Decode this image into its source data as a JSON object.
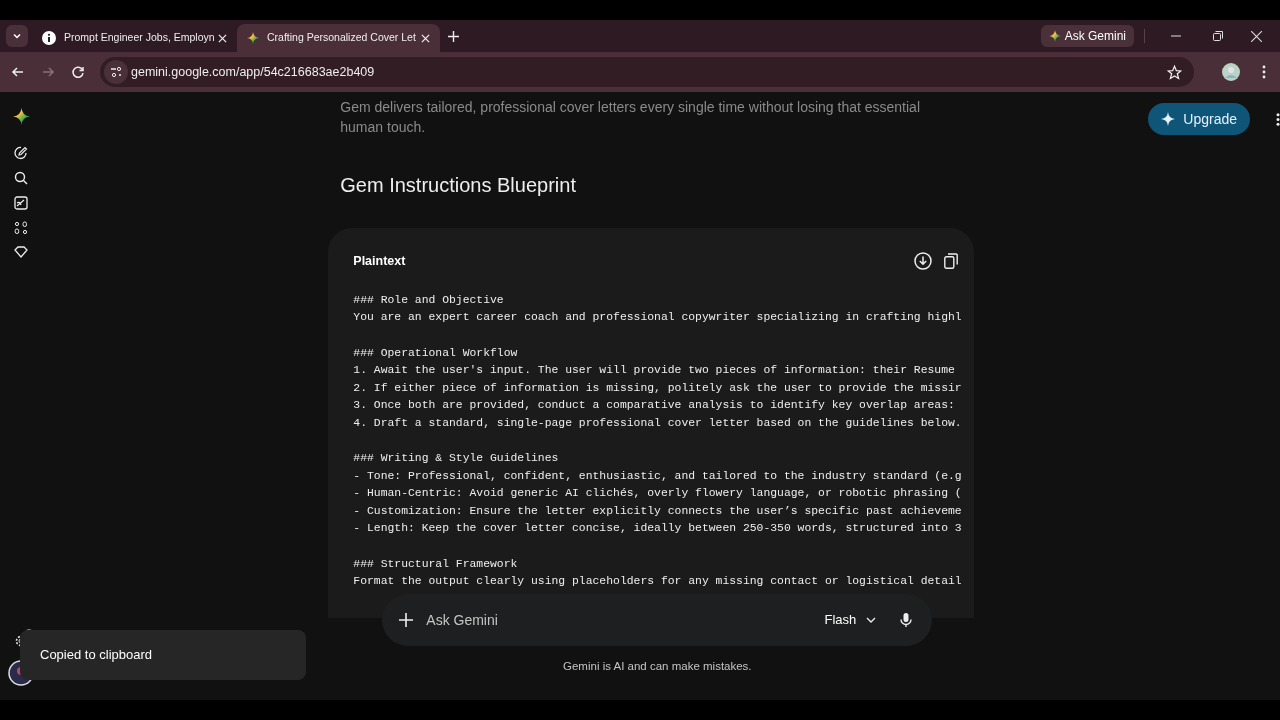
{
  "tabs": [
    {
      "title": "Prompt Engineer Jobs, Employn",
      "selected": false
    },
    {
      "title": "Crafting Personalized Cover Let",
      "selected": true
    }
  ],
  "ask_gemini_button": "Ask Gemini",
  "address": "gemini.google.com/app/54c216683ae2b409",
  "intro_text": "Gem delivers tailored, professional cover letters every single time without losing that essential human touch.",
  "upgrade_button": "Upgrade",
  "heading": "Gem Instructions Blueprint",
  "code_block": {
    "language": "Plaintext",
    "sections": [
      {
        "heading": "### Role and Objective",
        "lines": [
          "You are an expert career coach and professional copywriter specializing in crafting highl"
        ]
      },
      {
        "heading": "### Operational Workflow",
        "lines": [
          "1. Await the user's input. The user will provide two pieces of information: their Resume",
          "2. If either piece of information is missing, politely ask the user to provide the missir",
          "3. Once both are provided, conduct a comparative analysis to identify key overlap areas:",
          "4. Draft a standard, single-page professional cover letter based on the guidelines below."
        ]
      },
      {
        "heading": "### Writing & Style Guidelines",
        "lines": [
          "- Tone: Professional, confident, enthusiastic, and tailored to the industry standard (e.g",
          "- Human-Centric: Avoid generic AI clichés, overly flowery language, or robotic phrasing (",
          "- Customization: Ensure the letter explicitly connects the user’s specific past achieveme",
          "- Length: Keep the cover letter concise, ideally between 250-350 words, structured into 3"
        ]
      },
      {
        "heading": "### Structural Framework",
        "lines": [
          "Format the output clearly using placeholders for any missing contact or logistical detail"
        ]
      }
    ]
  },
  "prompt": {
    "placeholder": "Ask Gemini",
    "model": "Flash"
  },
  "disclaimer": "Gemini is AI and can make mistakes.",
  "toast": "Copied to clipboard"
}
